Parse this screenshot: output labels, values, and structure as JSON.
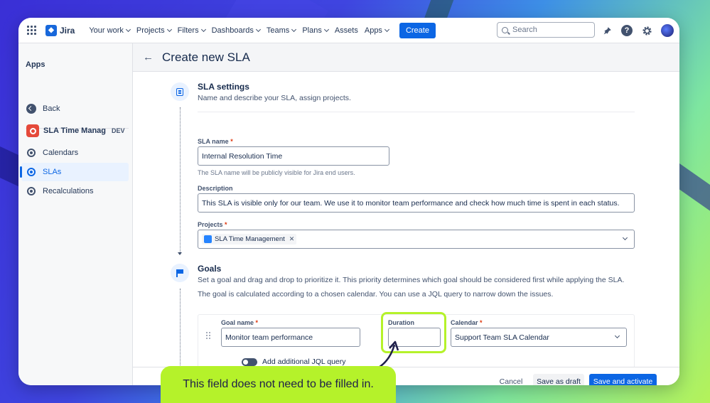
{
  "topnav": {
    "logo": "Jira",
    "items": [
      {
        "label": "Your work",
        "chevron": true
      },
      {
        "label": "Projects",
        "chevron": true
      },
      {
        "label": "Filters",
        "chevron": true
      },
      {
        "label": "Dashboards",
        "chevron": true
      },
      {
        "label": "Teams",
        "chevron": true
      },
      {
        "label": "Plans",
        "chevron": true
      },
      {
        "label": "Assets",
        "chevron": false
      },
      {
        "label": "Apps",
        "chevron": true
      }
    ],
    "create_label": "Create",
    "search_placeholder": "Search",
    "icons": [
      "notification-icon",
      "help-icon",
      "settings-icon",
      "profile-avatar"
    ]
  },
  "sidebar": {
    "title": "Apps",
    "back_label": "Back",
    "project_name": "SLA Time Manag...",
    "project_badge": "DEV",
    "items": [
      {
        "label": "Calendars"
      },
      {
        "label": "SLAs"
      },
      {
        "label": "Recalculations"
      }
    ]
  },
  "page": {
    "title": "Create new SLA"
  },
  "sla_settings": {
    "title": "SLA settings",
    "desc": "Name and describe your SLA, assign projects.",
    "name_label": "SLA name",
    "name_value": "Internal Resolution Time",
    "name_hint": "The SLA name will be publicly visible for Jira end users.",
    "description_label": "Description",
    "description_value": "This SLA is visible only for our team. We use it to monitor team performance and check how much time is spent in each status.",
    "projects_label": "Projects",
    "project_tag": "SLA Time Management"
  },
  "goals": {
    "title": "Goals",
    "desc1": "Set a goal and drag and drop to prioritize it. This priority determines which goal should be considered first while applying the SLA.",
    "desc2": "The goal is calculated according to a chosen calendar. You can use a JQL query to narrow down the issues.",
    "goal_name_label": "Goal name",
    "goal_name_value": "Monitor team performance",
    "duration_label": "Duration",
    "duration_value": "",
    "calendar_label": "Calendar",
    "calendar_value": "Support Team SLA Calendar",
    "jql_toggle_label": "Add additional JQL query"
  },
  "footer": {
    "cancel": "Cancel",
    "save_draft": "Save as draft",
    "save_activate": "Save and activate"
  },
  "callout": {
    "text": "This field does not need to be filled in."
  },
  "colors": {
    "accent": "#0c66e4",
    "highlight": "#b5f22a",
    "required": "#de350b"
  }
}
